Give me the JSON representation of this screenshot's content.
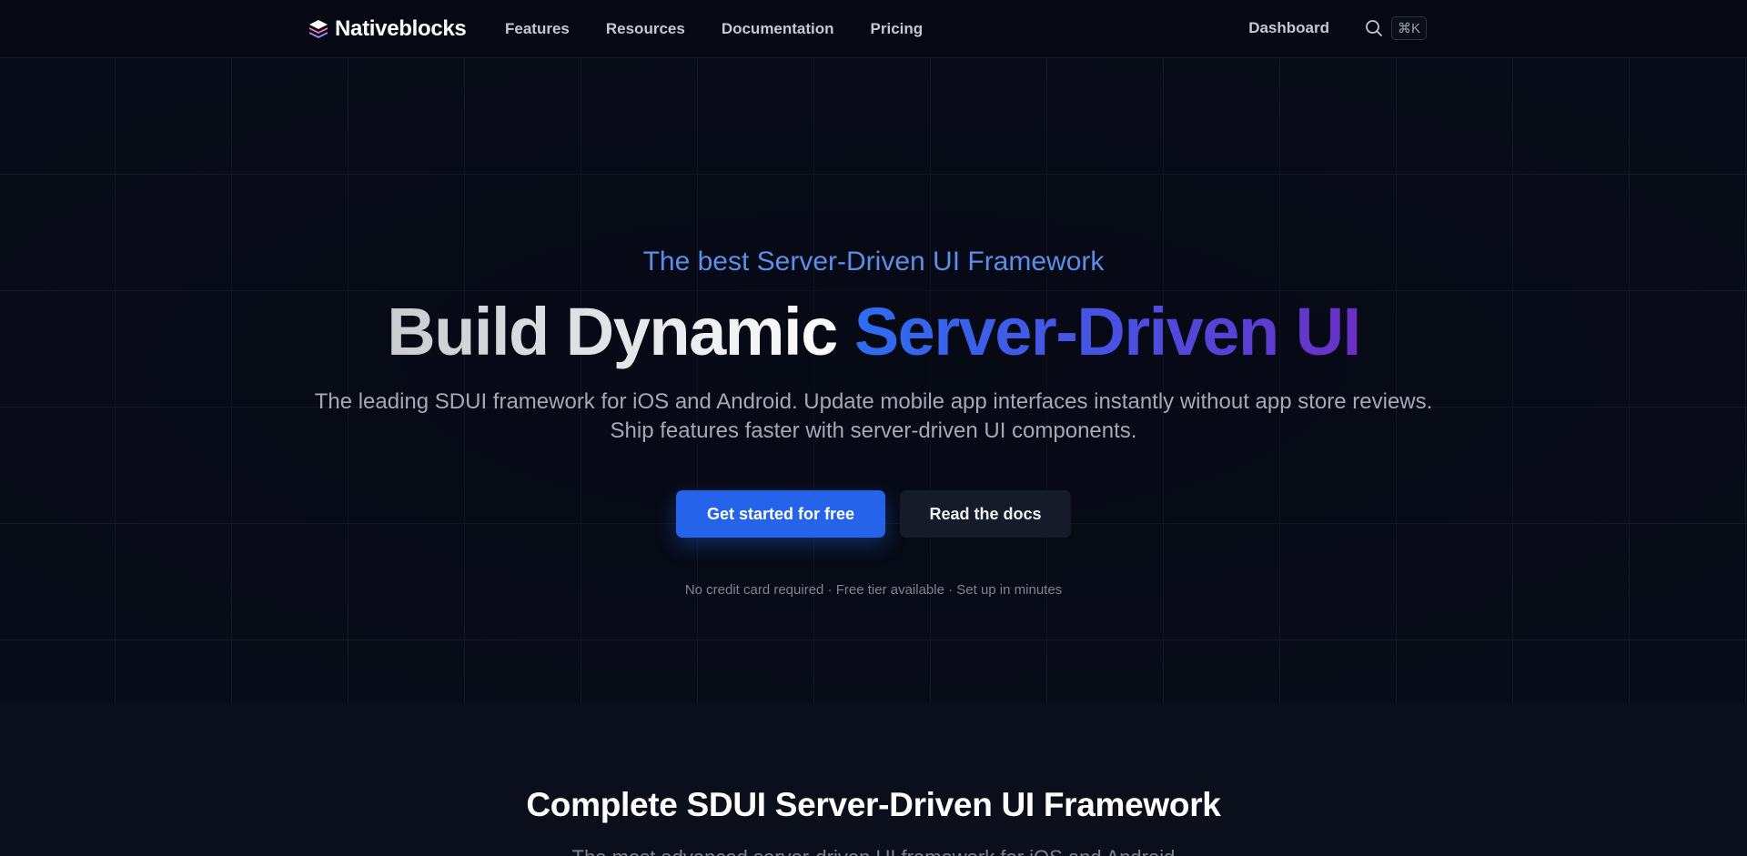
{
  "header": {
    "brand_name": "Nativeblocks",
    "nav": [
      "Features",
      "Resources",
      "Documentation",
      "Pricing"
    ],
    "dashboard_label": "Dashboard",
    "shortcut_label": "⌘K"
  },
  "hero": {
    "eyebrow": "The best Server-Driven UI Framework",
    "headline_plain": "Build Dynamic ",
    "headline_gradient": "Server-Driven UI",
    "subtext_line1": "The leading SDUI framework for iOS and Android. Update mobile app interfaces instantly without app store reviews.",
    "subtext_line2": "Ship features faster with server-driven UI components.",
    "primary_cta": "Get started for free",
    "secondary_cta": "Read the docs",
    "fineprint": "No credit card required · Free tier available · Set up in minutes"
  },
  "section": {
    "title": "Complete SDUI Server-Driven UI Framework",
    "subtitle_partial": "The most advanced server-driven UI framework for iOS and Android"
  },
  "colors": {
    "background": "#060914",
    "accent": "#2563eb",
    "eyebrow": "#5b8fe6",
    "gradient_end": "#6a2fc6"
  },
  "icons": {
    "logo": "stacked-layers-icon",
    "search": "search-icon"
  }
}
